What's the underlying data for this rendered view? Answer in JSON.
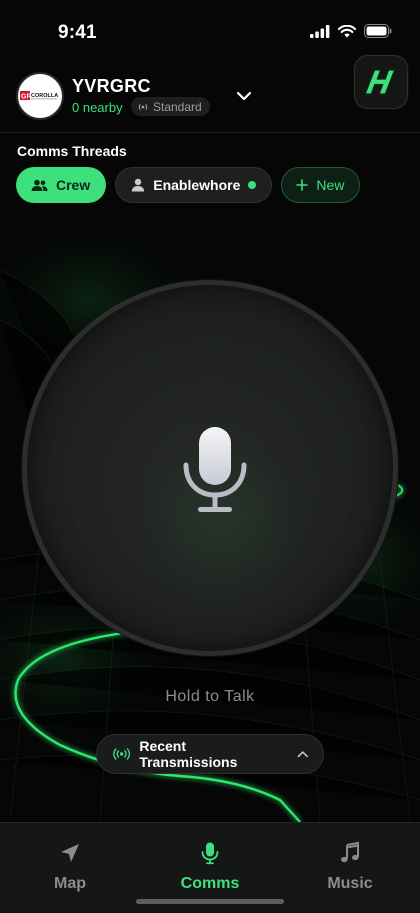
{
  "status_bar": {
    "time": "9:41"
  },
  "header": {
    "title": "YVRGRC",
    "nearby": "0 nearby",
    "mode": "Standard",
    "avatar_logo_text": "GR COROLLA"
  },
  "threads": {
    "label": "Comms Threads",
    "chips": [
      {
        "label": "Crew",
        "active": true
      },
      {
        "label": "Enablewhore",
        "online": true
      },
      {
        "label": "New"
      }
    ]
  },
  "ptt": {
    "hint": "Hold to Talk"
  },
  "recent": {
    "label": "Recent Transmissions"
  },
  "tabs": [
    {
      "label": "Map",
      "icon": "navigation-arrow-icon",
      "active": false
    },
    {
      "label": "Comms",
      "icon": "microphone-icon",
      "active": true
    },
    {
      "label": "Music",
      "icon": "music-note-icon",
      "active": false
    }
  ],
  "colors": {
    "accent": "#3ee07d",
    "background": "#050605",
    "surface": "#1e201f"
  }
}
